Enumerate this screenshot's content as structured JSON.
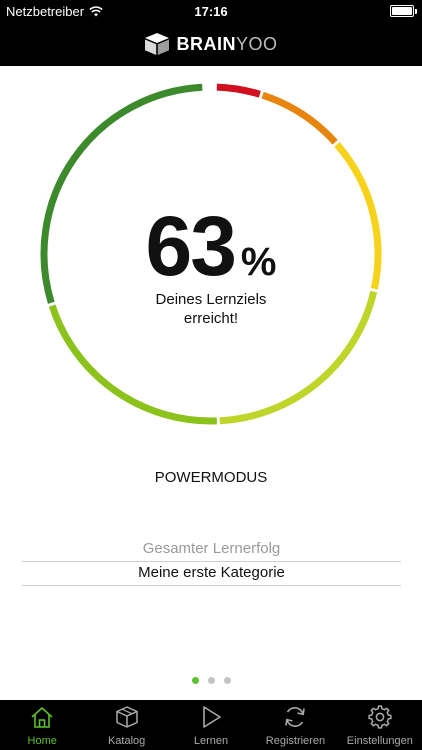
{
  "status_bar": {
    "carrier": "Netzbetreiber",
    "time": "17:16",
    "icons": [
      "wifi-icon",
      "battery-icon"
    ]
  },
  "header": {
    "logo_bold": "BRAIN",
    "logo_light": "YOO",
    "logo_icon": "brainyoo-box-icon"
  },
  "progress": {
    "percent_label": "63",
    "percent_sign": "%",
    "percent_value": 63,
    "caption_line1": "Deines Lernziels",
    "caption_line2": "erreicht!",
    "segment_colors": [
      "#d0101f",
      "#e8850e",
      "#f6d21a",
      "#bfd52a",
      "#8cc21c",
      "#3d8a2c"
    ]
  },
  "mode_label": "POWERMODUS",
  "list": {
    "items": [
      {
        "label": "Gesamter Lernerfolg"
      },
      {
        "label": "Meine erste Kategorie"
      }
    ]
  },
  "pager": {
    "count": 3,
    "active": 1
  },
  "tabbar": {
    "accent": "#5cc12e",
    "items": [
      {
        "label": "Home",
        "icon": "home-icon"
      },
      {
        "label": "Katalog",
        "icon": "catalog-box-icon"
      },
      {
        "label": "Lernen",
        "icon": "play-icon"
      },
      {
        "label": "Registrieren",
        "icon": "sync-icon"
      },
      {
        "label": "Einstellungen",
        "icon": "gear-icon"
      }
    ]
  }
}
